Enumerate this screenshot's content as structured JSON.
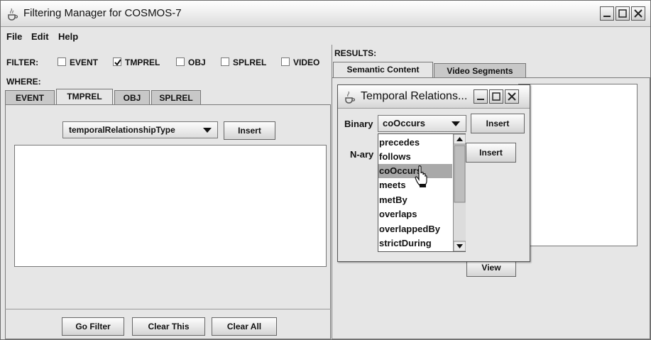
{
  "window": {
    "title": "Filtering Manager for COSMOS-7",
    "controls": [
      "minimize-icon",
      "maximize-icon",
      "close-icon"
    ]
  },
  "menu": {
    "items": [
      "File",
      "Edit",
      "Help"
    ]
  },
  "filter": {
    "label": "FILTER:",
    "options": [
      {
        "label": "EVENT",
        "checked": false
      },
      {
        "label": "TMPREL",
        "checked": true
      },
      {
        "label": "OBJ",
        "checked": false
      },
      {
        "label": "SPLREL",
        "checked": false
      },
      {
        "label": "VIDEO",
        "checked": false
      }
    ]
  },
  "where": {
    "label": "WHERE:",
    "tabs": [
      "EVENT",
      "TMPREL",
      "OBJ",
      "SPLREL"
    ],
    "active_tab": "TMPREL",
    "combo_value": "temporalRelationshipType",
    "insert_label": "Insert"
  },
  "footer_buttons": {
    "go": "Go Filter",
    "clear_this": "Clear This",
    "clear_all": "Clear All"
  },
  "results": {
    "label": "RESULTS:",
    "tabs": [
      "Semantic Content",
      "Video Segments"
    ],
    "active_tab": "Semantic Content",
    "view_label": "View"
  },
  "dialog": {
    "title": "Temporal Relations...",
    "binary_label": "Binary",
    "binary_value": "coOccurs",
    "insert1_label": "Insert",
    "nary_label": "N-ary",
    "insert2_label": "Insert",
    "list_items": [
      "precedes",
      "follows",
      "coOccurs",
      "meets",
      "metBy",
      "overlaps",
      "overlappedBy",
      "strictDuring"
    ],
    "highlighted_item": "coOccurs"
  }
}
